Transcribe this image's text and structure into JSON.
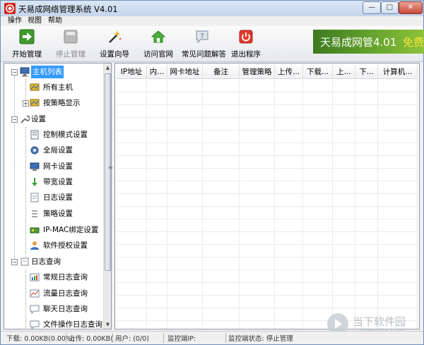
{
  "window": {
    "title": "天易成网络管理系统 V4.01",
    "min_glyph": "—",
    "max_glyph": "□",
    "close_glyph": "✕"
  },
  "menu": [
    "操作",
    "视图",
    "帮助"
  ],
  "toolbar": {
    "start": "开始管理",
    "stop": "停止管理",
    "wizard": "设置向导",
    "website": "访问官网",
    "faq": "常见问题解答",
    "exit": "退出程序"
  },
  "banner": {
    "text": "天易成网管4.01",
    "free": "免费"
  },
  "tree": {
    "host_list": "主机列表",
    "all_hosts": "所有主机",
    "by_policy": "按策略显示",
    "settings": "设置",
    "control_mode": "控制模式设置",
    "global": "全局设置",
    "nic": "网卡设置",
    "bandwidth": "带宽设置",
    "log": "日志设置",
    "policy": "策略设置",
    "ipmac": "IP-MAC绑定设置",
    "license": "软件授权设置",
    "log_query": "日志查询",
    "normal_log": "常规日志查询",
    "traffic_log": "流量日志查询",
    "chat_log": "聊天日志查询",
    "file_log": "文件操作日志查询"
  },
  "list": {
    "columns": [
      "IP地址",
      "内...",
      "网卡地址",
      "备注",
      "管理策略",
      "上传...",
      "下载...",
      "上...",
      "下...",
      "计算机..."
    ]
  },
  "watermark": {
    "text": "当下软件园",
    "url": "downxia.com"
  },
  "status": {
    "download": "下载: 0.00KB(0.00%)",
    "upload": "上传: 0.00KB(0.00",
    "users": "用户: (0/0)",
    "monitor_ip": "监控端IP:",
    "monitor_state": "监控端状态: 停止管理"
  }
}
